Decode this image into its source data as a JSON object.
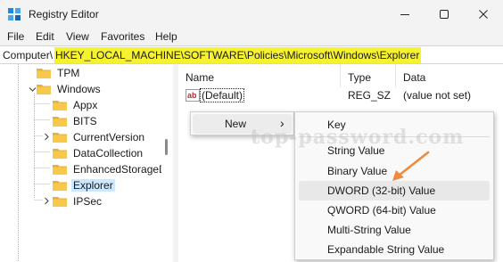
{
  "window": {
    "title": "Registry Editor"
  },
  "icons": {
    "app": "registry-editor-icon",
    "minimize": "minimize-icon",
    "maximize": "maximize-icon",
    "close": "close-icon",
    "folder": "folder-icon",
    "expand": "chevron-right-icon",
    "collapse": "chevron-down-icon",
    "string_value": "ab-string-icon",
    "submenu": "chevron-right-icon"
  },
  "menubar": [
    "File",
    "Edit",
    "View",
    "Favorites",
    "Help"
  ],
  "address": {
    "prefix": "Computer\\",
    "path": "HKEY_LOCAL_MACHINE\\SOFTWARE\\Policies\\Microsoft\\Windows\\Explorer"
  },
  "tree": [
    {
      "label": "TPM",
      "expander": "none",
      "selected": false
    },
    {
      "label": "Windows",
      "expander": "expanded",
      "selected": false
    },
    {
      "label": "Appx",
      "expander": "none",
      "selected": false
    },
    {
      "label": "BITS",
      "expander": "none",
      "selected": false
    },
    {
      "label": "CurrentVersion",
      "expander": "collapsed",
      "selected": false
    },
    {
      "label": "DataCollection",
      "expander": "none",
      "selected": false
    },
    {
      "label": "EnhancedStorageD",
      "expander": "none",
      "selected": false
    },
    {
      "label": "Explorer",
      "expander": "none",
      "selected": true
    },
    {
      "label": "IPSec",
      "expander": "collapsed",
      "selected": false
    }
  ],
  "columns": [
    "Name",
    "Type",
    "Data"
  ],
  "values": [
    {
      "name": "(Default)",
      "type": "REG_SZ",
      "data": "(value not set)"
    }
  ],
  "context_menu": {
    "new_label": "New",
    "submenu_glyph": "›",
    "submenu": [
      {
        "label": "Key",
        "highlighted": false
      },
      {
        "label": "String Value",
        "highlighted": false
      },
      {
        "label": "Binary Value",
        "highlighted": false
      },
      {
        "label": "DWORD (32-bit) Value",
        "highlighted": true
      },
      {
        "label": "QWORD (64-bit) Value",
        "highlighted": false
      },
      {
        "label": "Multi-String Value",
        "highlighted": false
      },
      {
        "label": "Expandable String Value",
        "highlighted": false
      }
    ]
  },
  "colors": {
    "address_highlight": "#f6f230",
    "selection": "#cce8ff",
    "arrow": "#f08a3c",
    "folder": "#f7c84a"
  },
  "watermark": "top-password.com"
}
